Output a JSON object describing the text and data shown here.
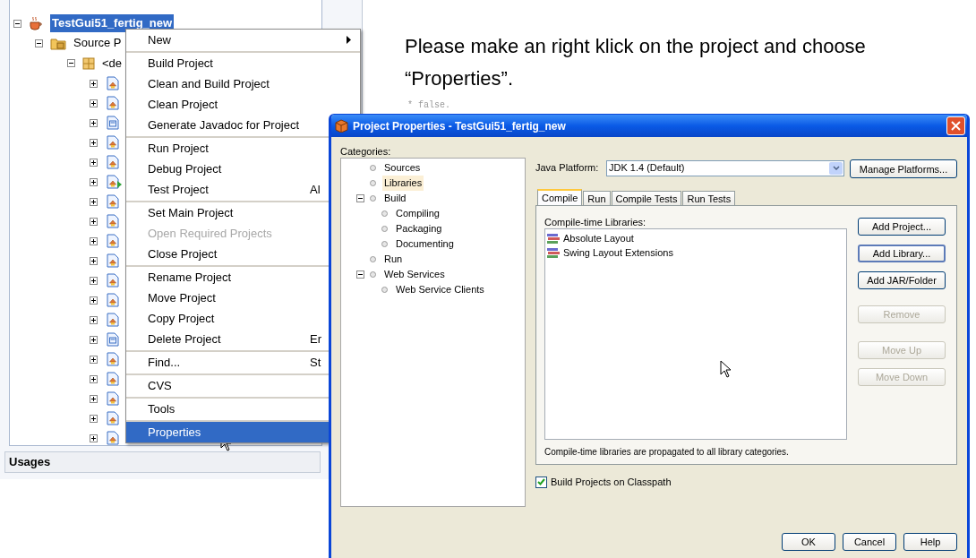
{
  "instruction": "Please make an right klick on the project and choose “Properties”.",
  "code_fragment": "* false.",
  "project_tree": {
    "project": {
      "label": "TestGui51_fertig_new",
      "selected": true,
      "expanded": true
    },
    "source_node": {
      "label": "Source P",
      "expanded": true
    },
    "package_node": {
      "label": "<de",
      "expanded": true
    },
    "files": [
      {
        "kind": "form",
        "expanded": false
      },
      {
        "kind": "form",
        "expanded": false
      },
      {
        "kind": "document",
        "expanded": false
      },
      {
        "kind": "form",
        "expanded": false
      },
      {
        "kind": "form",
        "expanded": false
      },
      {
        "kind": "main",
        "expanded": false
      },
      {
        "kind": "form",
        "expanded": false
      },
      {
        "kind": "form",
        "expanded": false
      },
      {
        "kind": "form",
        "expanded": false
      },
      {
        "kind": "form",
        "expanded": false
      },
      {
        "kind": "form",
        "expanded": false
      },
      {
        "kind": "form",
        "expanded": false
      },
      {
        "kind": "form",
        "expanded": false
      },
      {
        "kind": "document",
        "expanded": false
      },
      {
        "kind": "form",
        "expanded": false
      },
      {
        "kind": "form",
        "expanded": false
      },
      {
        "kind": "form",
        "expanded": false
      },
      {
        "kind": "form",
        "expanded": false
      },
      {
        "kind": "form",
        "expanded": false
      }
    ]
  },
  "context_menu": [
    [
      {
        "label": "New",
        "submenu": true,
        "disabled": false,
        "selected": false
      }
    ],
    [
      {
        "label": "Build Project",
        "disabled": false,
        "selected": false
      },
      {
        "label": "Clean and Build Project",
        "disabled": false,
        "selected": false
      },
      {
        "label": "Clean Project",
        "disabled": false,
        "selected": false
      },
      {
        "label": "Generate Javadoc for Project",
        "disabled": false,
        "selected": false
      }
    ],
    [
      {
        "label": "Run Project",
        "disabled": false,
        "selected": false
      },
      {
        "label": "Debug Project",
        "disabled": false,
        "selected": false
      },
      {
        "label": "Test Project",
        "shortcut": "Al",
        "disabled": false,
        "selected": false
      }
    ],
    [
      {
        "label": "Set Main Project",
        "disabled": false,
        "selected": false
      },
      {
        "label": "Open Required Projects",
        "disabled": true,
        "selected": false
      },
      {
        "label": "Close Project",
        "disabled": false,
        "selected": false
      }
    ],
    [
      {
        "label": "Rename Project",
        "disabled": false,
        "selected": false
      },
      {
        "label": "Move Project",
        "disabled": false,
        "selected": false
      },
      {
        "label": "Copy Project",
        "disabled": false,
        "selected": false
      },
      {
        "label": "Delete Project",
        "shortcut": "Er",
        "disabled": false,
        "selected": false
      }
    ],
    [
      {
        "label": "Find...",
        "shortcut": "St",
        "disabled": false,
        "selected": false
      }
    ],
    [
      {
        "label": "CVS",
        "disabled": false,
        "selected": false
      }
    ],
    [
      {
        "label": "Tools",
        "disabled": false,
        "selected": false
      }
    ],
    [
      {
        "label": "Properties",
        "disabled": false,
        "selected": true
      }
    ]
  ],
  "usages_panel": {
    "title": "Usages"
  },
  "dialog": {
    "title": "Project Properties - TestGui51_fertig_new",
    "categories_label": "Categories:",
    "categories": [
      {
        "label": "Sources",
        "selected": false
      },
      {
        "label": "Libraries",
        "selected": true
      },
      {
        "label": "Build",
        "selected": false,
        "expanded": true,
        "children": [
          {
            "label": "Compiling",
            "selected": false
          },
          {
            "label": "Packaging",
            "selected": false
          },
          {
            "label": "Documenting",
            "selected": false
          }
        ]
      },
      {
        "label": "Run",
        "selected": false
      },
      {
        "label": "Web Services",
        "selected": false,
        "expanded": true,
        "children": [
          {
            "label": "Web Service Clients",
            "selected": false
          }
        ]
      }
    ],
    "java_platform_label": "Java Platform:",
    "java_platform_value": "JDK 1.4 (Default)",
    "manage_button": "Manage Platforms...",
    "tabs": [
      {
        "label": "Compile",
        "selected": true
      },
      {
        "label": "Run",
        "selected": false
      },
      {
        "label": "Compile Tests",
        "selected": false
      },
      {
        "label": "Run Tests",
        "selected": false
      }
    ],
    "libraries_label": "Compile-time Libraries:",
    "libraries": [
      "Absolute Layout",
      "Swing Layout Extensions"
    ],
    "side_buttons": [
      {
        "label": "Add Project...",
        "disabled": false,
        "focused": false
      },
      {
        "label": "Add Library...",
        "disabled": false,
        "focused": true
      },
      {
        "label": "Add JAR/Folder",
        "disabled": false,
        "focused": false
      },
      {
        "label": "Remove",
        "disabled": true,
        "focused": false
      },
      {
        "label": "Move Up",
        "disabled": true,
        "focused": false
      },
      {
        "label": "Move Down",
        "disabled": true,
        "focused": false
      }
    ],
    "note": "Compile-time libraries are propagated to all library categories.",
    "checkbox": {
      "label": "Build Projects on Classpath",
      "checked": true
    },
    "footer_buttons": [
      "OK",
      "Cancel",
      "Help"
    ]
  }
}
